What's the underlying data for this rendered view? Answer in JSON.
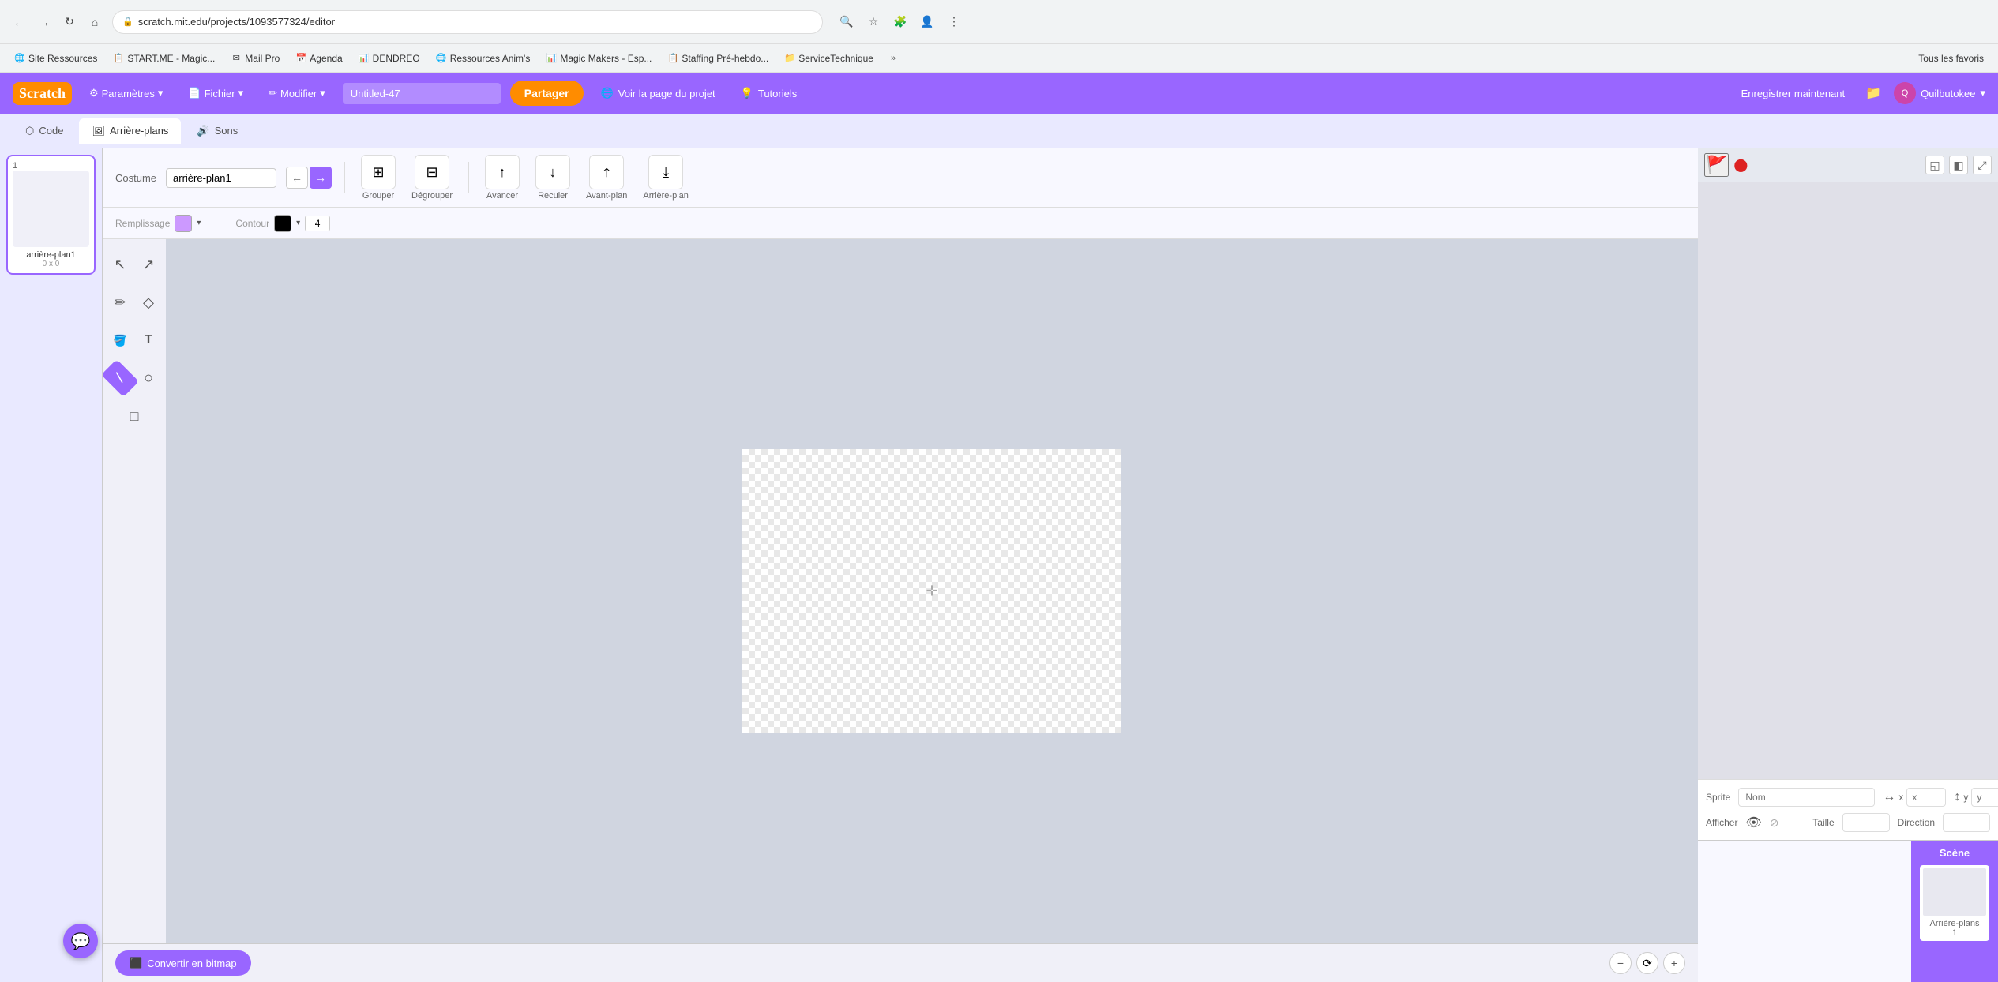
{
  "browser": {
    "back_btn": "←",
    "forward_btn": "→",
    "reload_btn": "↻",
    "home_btn": "⌂",
    "url": "scratch.mit.edu/projects/1093577324/editor",
    "search_icon": "🔍",
    "star_icon": "☆",
    "extension_icon": "🧩",
    "account_icon": "👤",
    "more_icon": "⋮"
  },
  "bookmarks": [
    {
      "label": "Site Ressources",
      "icon": "🌐"
    },
    {
      "label": "START.ME - Magic...",
      "icon": "📋"
    },
    {
      "label": "Mail Pro",
      "icon": "✉"
    },
    {
      "label": "Agenda",
      "icon": "📅"
    },
    {
      "label": "DENDREO",
      "icon": "📊"
    },
    {
      "label": "Ressources Anim's",
      "icon": "🌐"
    },
    {
      "label": "Magic Makers - Esp...",
      "icon": "📊"
    },
    {
      "label": "Staffing Pré-hebdo...",
      "icon": "📋"
    },
    {
      "label": "ServiceTechnique",
      "icon": "📁"
    }
  ],
  "bookmarks_more": "»",
  "bookmarks_all": "Tous les favoris",
  "scratch": {
    "logo": "Scratch",
    "paramètres_label": "Paramètres",
    "fichier_label": "Fichier",
    "modifier_label": "Modifier",
    "project_name": "Untitled-47",
    "partager_label": "Partager",
    "voir_label": "Voir la page du projet",
    "tutoriels_label": "Tutoriels",
    "enregistrer_label": "Enregistrer maintenant",
    "user_label": "Quilbutokee",
    "dropdown_icon": "▾"
  },
  "tabs": [
    {
      "label": "Code",
      "icon": "⬡",
      "active": false
    },
    {
      "label": "Arrière-plans",
      "icon": "🖼",
      "active": true
    },
    {
      "label": "Sons",
      "icon": "🔊",
      "active": false
    }
  ],
  "costume_panel": {
    "item": {
      "number": "1",
      "name": "arrière-plan1",
      "dims": "0 x 0"
    }
  },
  "toolbar": {
    "costume_label": "Costume",
    "costume_name": "arrière-plan1",
    "dir_left_icon": "←",
    "dir_right_icon": "→",
    "grouper_label": "Grouper",
    "degrouper_label": "Dégrouper",
    "avancer_label": "Avancer",
    "reculer_label": "Reculer",
    "avant_plan_label": "Avant-plan",
    "arriere_plan_label": "Arrière-plan",
    "remplissage_label": "Remplissage",
    "contour_label": "Contour",
    "stroke_width": "4",
    "fill_color": "#cc99ff",
    "stroke_color": "#000000"
  },
  "tools": [
    {
      "name": "select",
      "icon": "↖",
      "label": "Sélection",
      "active": false
    },
    {
      "name": "reshape",
      "icon": "↗",
      "label": "Remodeler",
      "active": false
    },
    {
      "name": "pencil",
      "icon": "✏",
      "label": "Crayon",
      "active": false
    },
    {
      "name": "eraser",
      "icon": "◇",
      "label": "Gomme",
      "active": false
    },
    {
      "name": "fill",
      "icon": "🪣",
      "label": "Remplir",
      "active": false
    },
    {
      "name": "text",
      "icon": "T",
      "label": "Texte",
      "active": false
    },
    {
      "name": "line",
      "icon": "/",
      "label": "Ligne",
      "active": true
    },
    {
      "name": "circle",
      "icon": "○",
      "label": "Cercle",
      "active": false
    },
    {
      "name": "rect",
      "icon": "□",
      "label": "Rectangle",
      "active": false
    }
  ],
  "canvas": {
    "crosshair": "✛"
  },
  "bottom": {
    "convert_label": "Convertir en bitmap",
    "convert_icon": "⬛",
    "zoom_out": "−",
    "zoom_reset": "=",
    "zoom_in": "+"
  },
  "right_panel": {
    "stage_ctrl": {
      "flag_icon": "⚑",
      "stop_icon": "⬤"
    },
    "layout_btns": [
      "◱",
      "◧",
      "⤢"
    ],
    "sprite": {
      "label": "Sprite",
      "name_placeholder": "Nom",
      "x_label": "x",
      "x_placeholder": "x",
      "y_label": "y",
      "y_placeholder": "y",
      "afficher_label": "Afficher",
      "taille_label": "Taille",
      "direction_label": "Direction"
    },
    "scene": {
      "label": "Scène",
      "bg_label": "Arrière-plans",
      "bg_count": "1"
    }
  },
  "chat_btn": "💬",
  "plus_btn": "+"
}
